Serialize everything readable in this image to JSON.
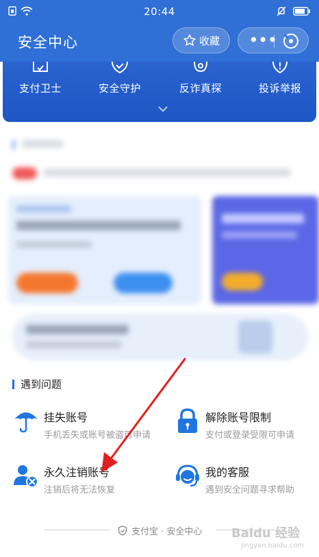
{
  "status_bar": {
    "time": "20:44"
  },
  "header": {
    "title": "安全中心",
    "favorite_label": "收藏"
  },
  "entries": [
    {
      "label": "支付卫士",
      "icon": "shield-scan-icon"
    },
    {
      "label": "安全守护",
      "icon": "shield-check-icon"
    },
    {
      "label": "反诈真探",
      "icon": "detective-icon"
    },
    {
      "label": "投诉举报",
      "icon": "alert-shield-icon"
    }
  ],
  "problems": {
    "title": "遇到问题",
    "items": [
      {
        "title": "挂失账号",
        "subtitle": "手机丢失或账号被盗可申请",
        "icon": "umbrella-icon"
      },
      {
        "title": "解除账号限制",
        "subtitle": "支付或登录受限可申请",
        "icon": "lock-icon"
      },
      {
        "title": "永久注销账号",
        "subtitle": "注销后将无法恢复",
        "icon": "user-remove-icon"
      },
      {
        "title": "我的客服",
        "subtitle": "遇到安全问题寻求帮助",
        "icon": "customer-service-icon"
      }
    ]
  },
  "footer": {
    "text": "支付宝 · 安全中心"
  },
  "watermark": {
    "text": "Baidu 经验",
    "url": "jingyan.baidu.com"
  },
  "colors": {
    "brand_blue": "#2f6fd6",
    "accent_blue": "#1e6fe0",
    "arrow_red": "#e02020"
  }
}
